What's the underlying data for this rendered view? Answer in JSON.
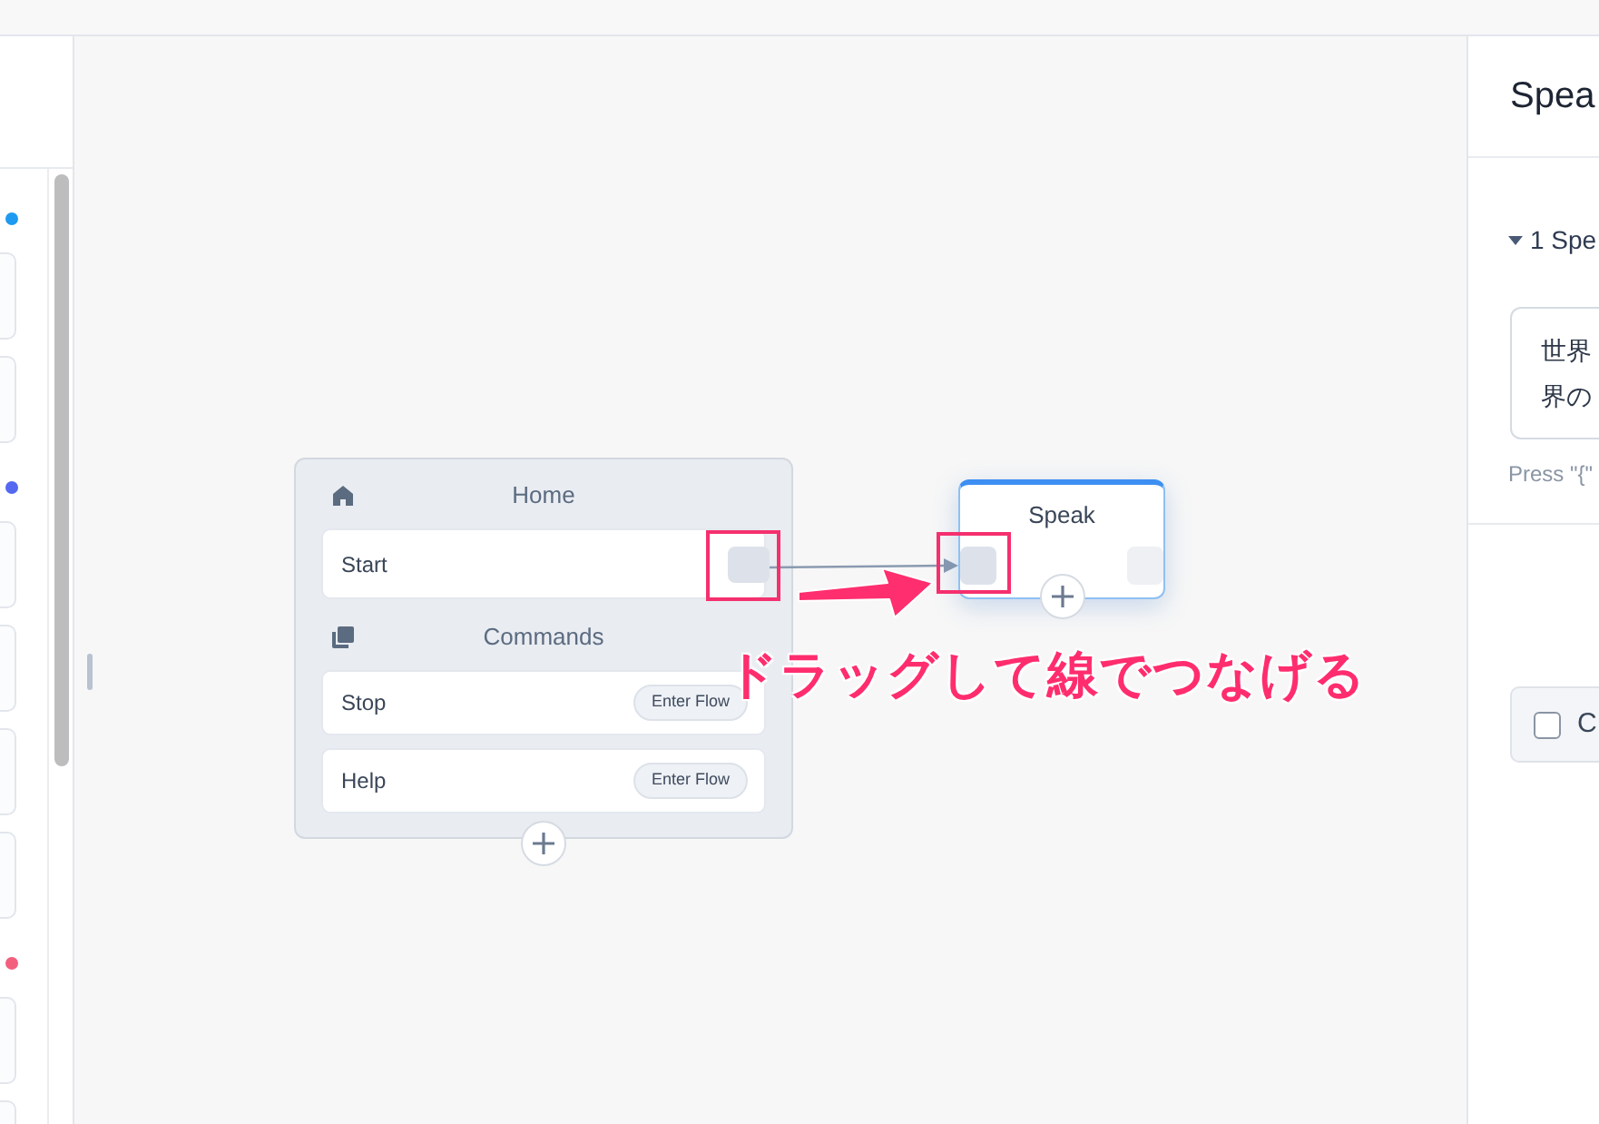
{
  "sidebar": {
    "entries": [
      {
        "kind": "dot",
        "color": "#1e9bf0"
      },
      {
        "kind": "card"
      },
      {
        "kind": "card"
      },
      {
        "kind": "dot",
        "color": "#5468f0"
      },
      {
        "kind": "card"
      },
      {
        "kind": "card"
      },
      {
        "kind": "card"
      },
      {
        "kind": "card"
      },
      {
        "kind": "dot",
        "color": "#f2607e"
      },
      {
        "kind": "card"
      },
      {
        "kind": "card"
      }
    ]
  },
  "canvas": {
    "home_block": {
      "sections": [
        {
          "kind": "home",
          "title": "Home",
          "rows": [
            {
              "kind": "port",
              "label": "Start"
            }
          ]
        },
        {
          "kind": "commands",
          "title": "Commands",
          "rows": [
            {
              "kind": "flow",
              "label": "Stop",
              "button": "Enter Flow"
            },
            {
              "kind": "flow",
              "label": "Help",
              "button": "Enter Flow"
            }
          ]
        }
      ]
    },
    "speak_node": {
      "title": "Speak"
    },
    "annotation": {
      "text": "ドラッグして線でつなげる"
    }
  },
  "panel": {
    "title": "Spea",
    "section": {
      "label": "1 Spe",
      "expanded": true
    },
    "text_lines": [
      "世界",
      "界の"
    ],
    "hint": "Press \"{\"",
    "checkbox": {
      "label": "C",
      "checked": false
    }
  }
}
